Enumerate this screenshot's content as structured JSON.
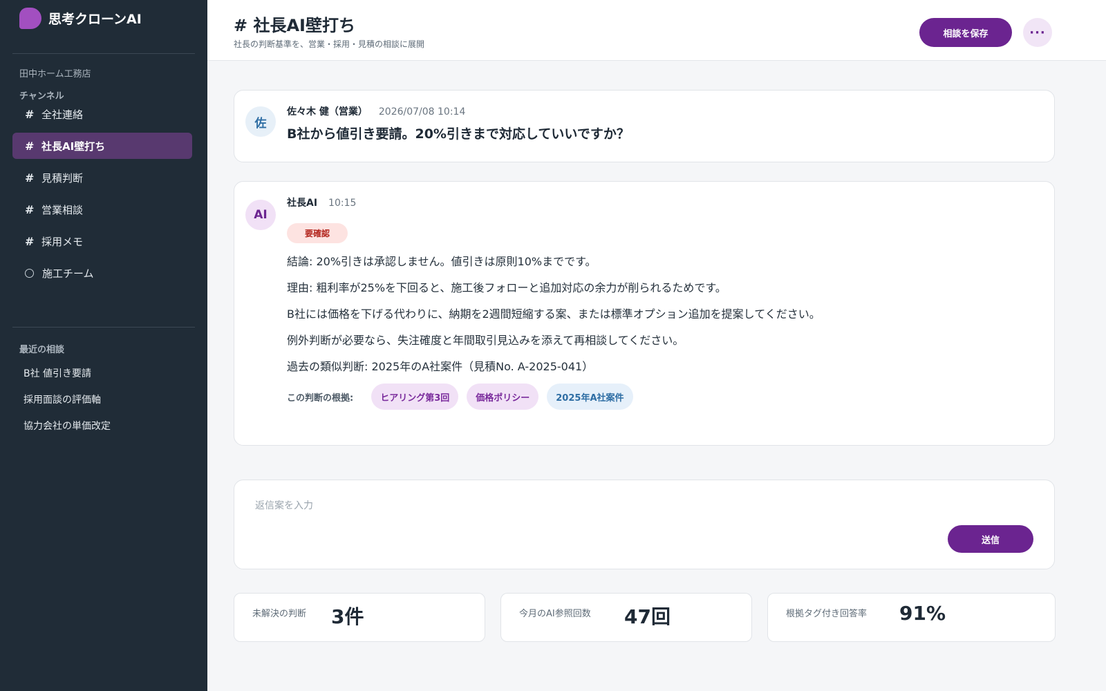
{
  "brand": {
    "name": "思考クローンAI"
  },
  "sidebar": {
    "workspace": "田中ホーム工務店",
    "channels_label": "チャンネル",
    "channels": [
      {
        "icon": "#",
        "label": "全社連絡"
      },
      {
        "icon": "#",
        "label": "社長AI壁打ち"
      },
      {
        "icon": "#",
        "label": "見積判断"
      },
      {
        "icon": "#",
        "label": "営業相談"
      },
      {
        "icon": "#",
        "label": "採用メモ"
      },
      {
        "icon": "circle-icon",
        "label": "施工チーム"
      }
    ],
    "recent_label": "最近の相談",
    "recent": [
      "B社 値引き要請",
      "採用面談の評価軸",
      "協力会社の単価改定"
    ]
  },
  "header": {
    "title": "# 社長AI壁打ち",
    "subtitle": "社長の判断基準を、営業・採用・見積の相談に展開",
    "save_label": "相談を保存",
    "more_label": "···"
  },
  "message_user": {
    "avatar": "佐",
    "author": "佐々木 健（営業）",
    "time": "2026/07/08 10:14",
    "text": "B社から値引き要請。20%引きまで対応していいですか？"
  },
  "message_ai": {
    "avatar": "AI",
    "author": "社長AI",
    "time": "10:15",
    "badge": "要確認",
    "lines": [
      "結論: 20%引きは承認しません。値引きは原則10%までです。",
      "理由: 粗利率が25%を下回ると、施工後フォローと追加対応の余力が削られるためです。",
      "B社には価格を下げる代わりに、納期を2週間短縮する案、または標準オプション追加を提案してください。",
      "例外判断が必要なら、失注確度と年間取引見込みを添えて再相談してください。",
      "過去の類似判断: 2025年のA社案件（見積No. A-2025-041）"
    ],
    "basis_label": "この判断の根拠:",
    "tags": [
      "ヒアリング第3回",
      "価格ポリシー",
      "2025年A社案件"
    ]
  },
  "composer": {
    "placeholder": "返信案を入力",
    "send_label": "送信"
  },
  "stats": [
    {
      "label": "未解決の判断",
      "value": "3件"
    },
    {
      "label": "今月のAI参照回数",
      "value": "47回"
    },
    {
      "label": "根拠タグ付き回答率",
      "value": "91%"
    }
  ],
  "colors": {
    "sidebar_bg": "#202c37",
    "accent": "#6b2490",
    "active_channel": "#58396f",
    "badge_warning": "#b3261e"
  }
}
